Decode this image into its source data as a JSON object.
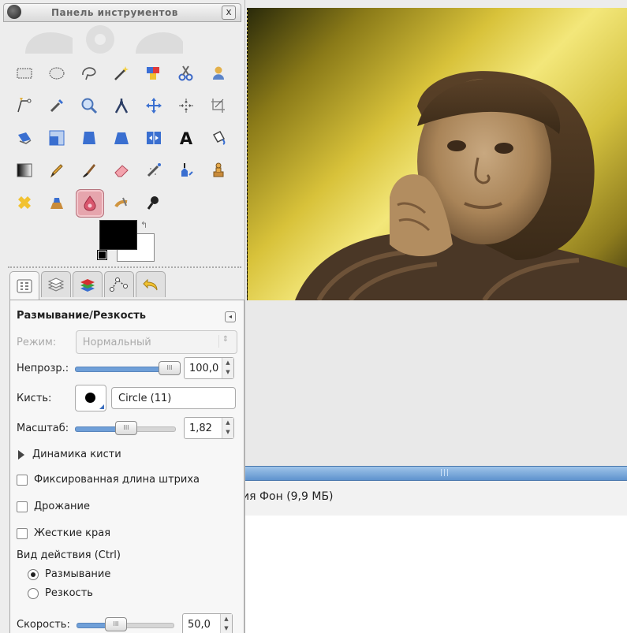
{
  "toolbox": {
    "title": "Панель инструментов",
    "close_label": "x"
  },
  "tools": [
    {
      "name": "rect-select-icon"
    },
    {
      "name": "ellipse-select-icon"
    },
    {
      "name": "free-select-icon"
    },
    {
      "name": "fuzzy-select-icon"
    },
    {
      "name": "select-by-color-icon"
    },
    {
      "name": "scissors-select-icon"
    },
    {
      "name": "foreground-select-icon"
    },
    {
      "name": "paths-icon"
    },
    {
      "name": "color-picker-icon"
    },
    {
      "name": "zoom-icon"
    },
    {
      "name": "measure-icon"
    },
    {
      "name": "move-icon"
    },
    {
      "name": "align-icon"
    },
    {
      "name": "crop-icon"
    },
    {
      "name": "rotate-icon"
    },
    {
      "name": "scale-icon"
    },
    {
      "name": "shear-icon"
    },
    {
      "name": "perspective-icon"
    },
    {
      "name": "flip-icon"
    },
    {
      "name": "text-icon"
    },
    {
      "name": "bucket-fill-icon"
    },
    {
      "name": "blend-icon"
    },
    {
      "name": "pencil-icon"
    },
    {
      "name": "paintbrush-icon"
    },
    {
      "name": "eraser-icon"
    },
    {
      "name": "airbrush-icon"
    },
    {
      "name": "ink-icon"
    },
    {
      "name": "clone-icon"
    },
    {
      "name": "heal-icon"
    },
    {
      "name": "perspective-clone-icon"
    },
    {
      "name": "blur-sharpen-icon",
      "active": true
    },
    {
      "name": "smudge-icon"
    },
    {
      "name": "dodge-burn-icon"
    }
  ],
  "colors": {
    "foreground": "#000000",
    "background": "#ffffff",
    "swap_glyph": "↰"
  },
  "options": {
    "title": "Размывание/Резкость",
    "mode_label": "Режим:",
    "mode_value": "Нормальный",
    "opacity_label": "Непрозр.:",
    "opacity_value": "100,0",
    "opacity_fraction": 1.0,
    "brush_label": "Кисть:",
    "brush_value": "Circle (11)",
    "scale_label": "Масштаб:",
    "scale_value": "1,82",
    "scale_fraction": 0.6,
    "dynamics_label": "Динамика кисти",
    "fixed_stroke_label": "Фиксированная длина штриха",
    "jitter_label": "Дрожание",
    "hard_edges_label": "Жесткие края",
    "action_label": "Вид действия  (Ctrl)",
    "action_blur_label": "Размывание",
    "action_sharpen_label": "Резкость",
    "action_selected": "blur",
    "speed_label": "Скорость:",
    "speed_value": "50,0",
    "speed_fraction": 0.5
  },
  "canvas": {
    "status_text": "ия Фон (9,9 МБ)",
    "scrollbar_grip": "|||"
  }
}
